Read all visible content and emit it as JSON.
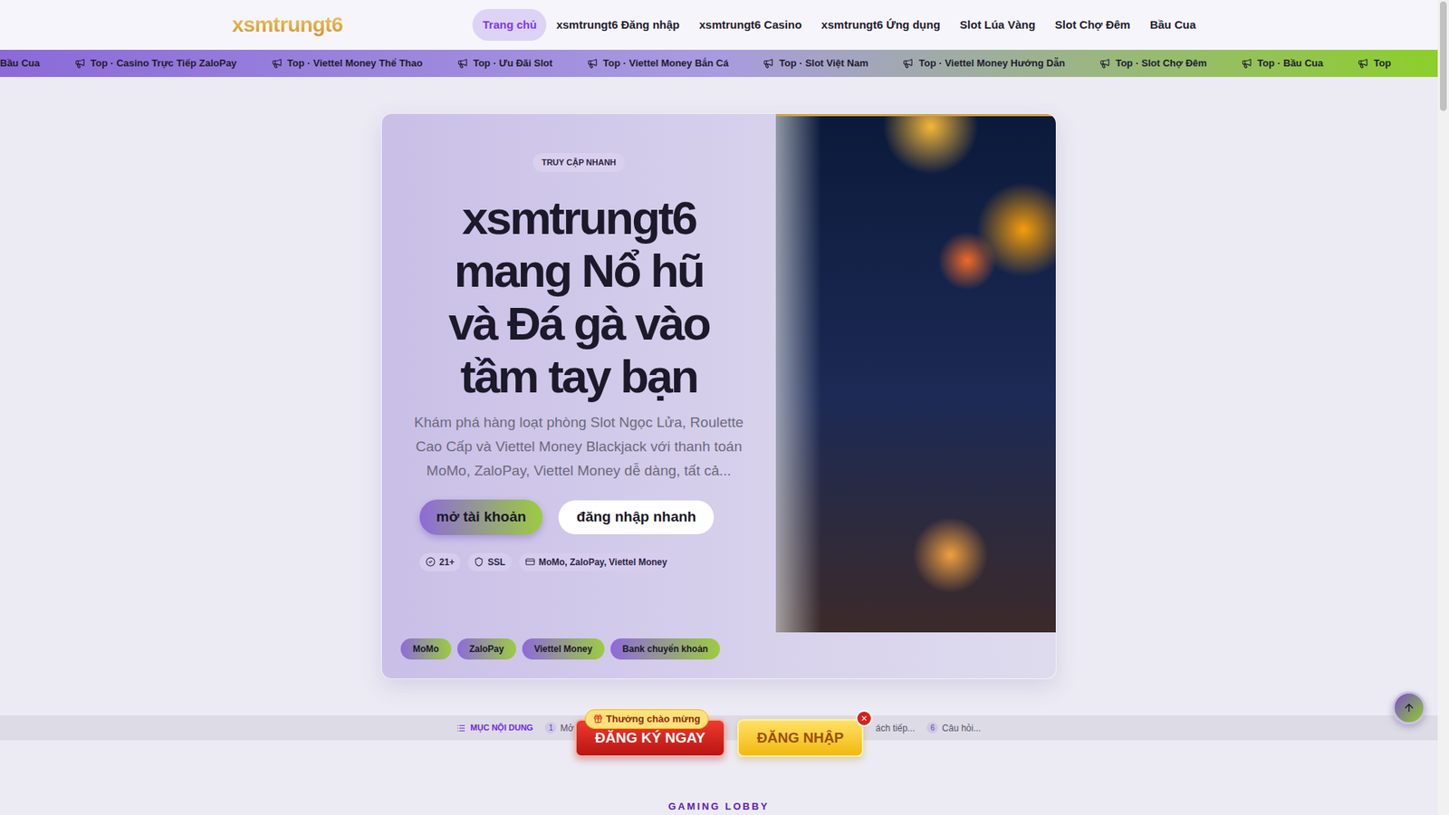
{
  "logo": "xsmtrungt6",
  "nav": [
    {
      "label": "Trang chủ",
      "selected": true
    },
    {
      "label": "xsmtrungt6 Đăng nhập",
      "selected": false
    },
    {
      "label": "xsmtrungt6 Casino",
      "selected": false
    },
    {
      "label": "xsmtrungt6 Ứng dụng",
      "selected": false
    },
    {
      "label": "Slot Lúa Vàng",
      "selected": false
    },
    {
      "label": "Slot Chợ Đêm",
      "selected": false
    },
    {
      "label": "Bầu Cua",
      "selected": false
    }
  ],
  "ticker": [
    {
      "label": "Bầu Cua",
      "icon": false
    },
    {
      "label": "Top · Casino Trực Tiếp ZaloPay",
      "icon": true
    },
    {
      "label": "Top · Viettel Money Thể Thao",
      "icon": true
    },
    {
      "label": "Top · Ưu Đãi Slot",
      "icon": true
    },
    {
      "label": "Top · Viettel Money Bắn Cá",
      "icon": true
    },
    {
      "label": "Top · Slot Việt Nam",
      "icon": true
    },
    {
      "label": "Top · Viettel Money Hướng Dẫn",
      "icon": true
    },
    {
      "label": "Top · Slot Chợ Đêm",
      "icon": true
    },
    {
      "label": "Top · Bầu Cua",
      "icon": true
    },
    {
      "label": "Top",
      "icon": true
    }
  ],
  "hero": {
    "badge": "TRUY CẬP NHANH",
    "title_lines": [
      "xsmtrungt6",
      "mang Nổ hũ",
      "và Đá gà vào",
      "tầm tay bạn"
    ],
    "description": "Khám phá hàng loạt phòng Slot Ngọc Lửa, Roulette Cao Cấp và Viettel Money Blackjack với thanh toán MoMo, ZaloPay, Viettel Money dễ dàng, tất cả...",
    "primary_button": "mở tài khoản",
    "secondary_button": "đăng nhập nhanh",
    "chips": [
      {
        "label": "21+",
        "kind": "age"
      },
      {
        "label": "SSL",
        "kind": "ssl"
      },
      {
        "label": "MoMo, ZaloPay, Viettel Money",
        "kind": "payment"
      }
    ],
    "payment_tags": [
      "MoMo",
      "ZaloPay",
      "Viettel Money",
      "Bank chuyển khoản"
    ]
  },
  "toc": {
    "title": "MỤC NỘI DUNG",
    "items": [
      {
        "num": "1",
        "label": "Mở"
      },
      {
        "num": "",
        "label": "ách tiếp..."
      },
      {
        "num": "6",
        "label": "Câu hỏi..."
      }
    ]
  },
  "cta": {
    "badge": "Thưởng chào mừng",
    "register": "ĐĂNG KÝ NGAY",
    "login": "ĐĂNG NHẬP",
    "close": "×"
  },
  "section_label": "GAMING LOBBY"
}
